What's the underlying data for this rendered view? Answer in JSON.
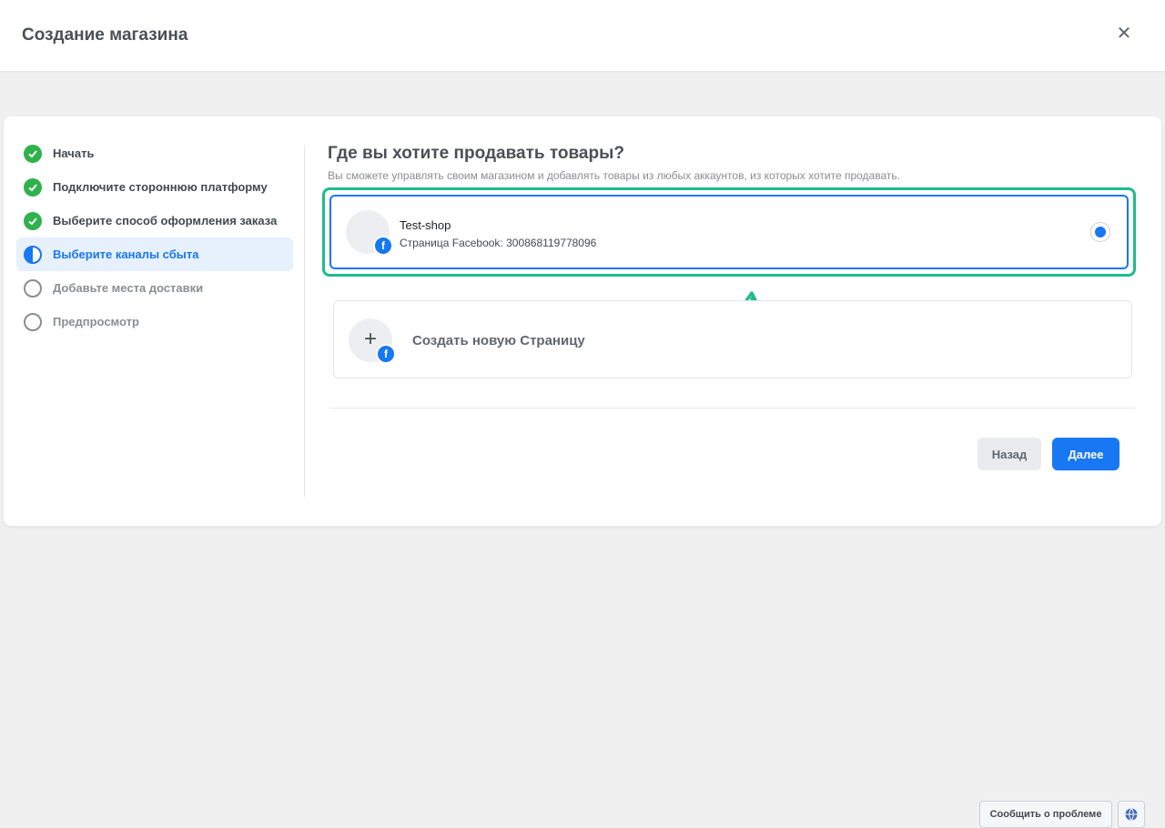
{
  "header": {
    "title": "Создание магазина",
    "close_icon": "close-icon"
  },
  "steps": [
    {
      "label": "Начать",
      "state": "done"
    },
    {
      "label": "Подключите стороннюю платформу",
      "state": "done"
    },
    {
      "label": "Выберите способ оформления заказа",
      "state": "done"
    },
    {
      "label": "Выберите каналы сбыта",
      "state": "active"
    },
    {
      "label": "Добавьте места доставки",
      "state": "pending"
    },
    {
      "label": "Предпросмотр",
      "state": "pending"
    }
  ],
  "main": {
    "title": "Где вы хотите продавать товары?",
    "subtitle": "Вы сможете управлять своим магазином и добавлять товары из любых аккаунтов, из которых хотите продавать.",
    "selected_page": {
      "name": "Test-shop",
      "type_label": "Страница",
      "meta": "Facebook: 300868119778096",
      "selected": true
    },
    "create_option": {
      "label": "Создать новую Страницу"
    }
  },
  "footer": {
    "back_label": "Назад",
    "next_label": "Далее"
  },
  "bottom": {
    "report_label": "Сообщить о проблеме"
  },
  "colors": {
    "accent": "#1877f2",
    "done": "#2fb24c",
    "highlight": "#1fbc8a"
  }
}
